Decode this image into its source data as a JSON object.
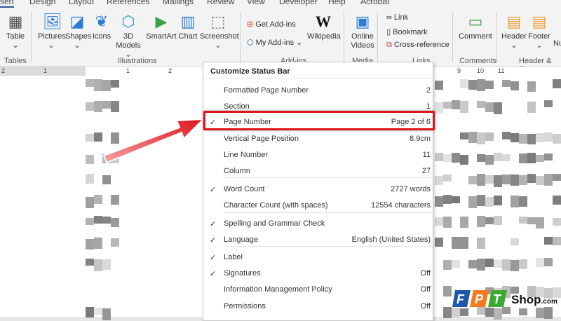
{
  "tabs": [
    "sert",
    "Design",
    "Layout",
    "References",
    "Mailings",
    "Review",
    "View",
    "Developer",
    "Help",
    "Acrobat"
  ],
  "ribbon": {
    "buttons": [
      {
        "label": "Table",
        "sub": "⌄",
        "icon": "table-icon"
      },
      {
        "label": "Pictures",
        "sub": "⌄",
        "icon": "pictures-icon"
      },
      {
        "label": "Shapes",
        "sub": "⌄",
        "icon": "shapes-icon"
      },
      {
        "label": "Icons",
        "icon": "icons-icon"
      },
      {
        "label": "3D",
        "sub": "Models ⌄",
        "icon": "3d-models-icon"
      },
      {
        "label": "SmartArt",
        "icon": "smartart-icon"
      },
      {
        "label": "Chart",
        "icon": "chart-icon"
      },
      {
        "label": "Screenshot",
        "sub": "⌄",
        "icon": "screenshot-icon"
      },
      {
        "label": "Wikipedia",
        "icon": "wikipedia-icon"
      },
      {
        "label": "Online",
        "sub": "Videos",
        "icon": "online-videos-icon"
      },
      {
        "label": "Comment",
        "icon": "comment-icon"
      },
      {
        "label": "Header",
        "sub": "⌄",
        "icon": "header-icon"
      },
      {
        "label": "Footer",
        "sub": "⌄",
        "icon": "footer-icon"
      },
      {
        "label": "Nu"
      }
    ],
    "addins": {
      "get": "Get Add-ins",
      "my": "My Add-ins"
    },
    "links": [
      "Link",
      "Bookmark",
      "Cross-reference"
    ],
    "groups": [
      "Tables",
      "Illustrations",
      "Add-ins",
      "Media",
      "Links",
      "Comments",
      "Header & Foo"
    ]
  },
  "ruler": [
    "2",
    "1",
    "1",
    "2",
    "9",
    "10",
    "11"
  ],
  "menu": {
    "title": "Customize Status Bar",
    "items": [
      {
        "label": "Formatted Page Number",
        "value": "2",
        "checked": false
      },
      {
        "label": "Section",
        "value": "1",
        "checked": false
      },
      {
        "label": "Page Number",
        "value": "Page 2 of 6",
        "checked": true
      },
      {
        "label": "Vertical Page Position",
        "value": "8.9cm",
        "checked": false
      },
      {
        "label": "Line Number",
        "value": "11",
        "checked": false
      },
      {
        "label": "Column",
        "value": "27",
        "checked": false
      },
      {
        "label": "Word Count",
        "value": "2727 words",
        "checked": true
      },
      {
        "label": "Character Count (with spaces)",
        "value": "12554 characters",
        "checked": false
      },
      {
        "label": "Spelling and Grammar Check",
        "value": "",
        "checked": true
      },
      {
        "label": "Language",
        "value": "English (United States)",
        "checked": true
      },
      {
        "label": "Label",
        "value": "",
        "checked": true
      },
      {
        "label": "Signatures",
        "value": "Off",
        "checked": true
      },
      {
        "label": "Information Management Policy",
        "value": "Off",
        "checked": false
      },
      {
        "label": "Permissions",
        "value": "Off",
        "checked": false
      }
    ]
  },
  "highlight_color": "#e0141c",
  "watermark": {
    "brand": "FPT",
    "text": "Shop",
    ".suffix": ".com.vn",
    "suffix": ".com.vn"
  }
}
